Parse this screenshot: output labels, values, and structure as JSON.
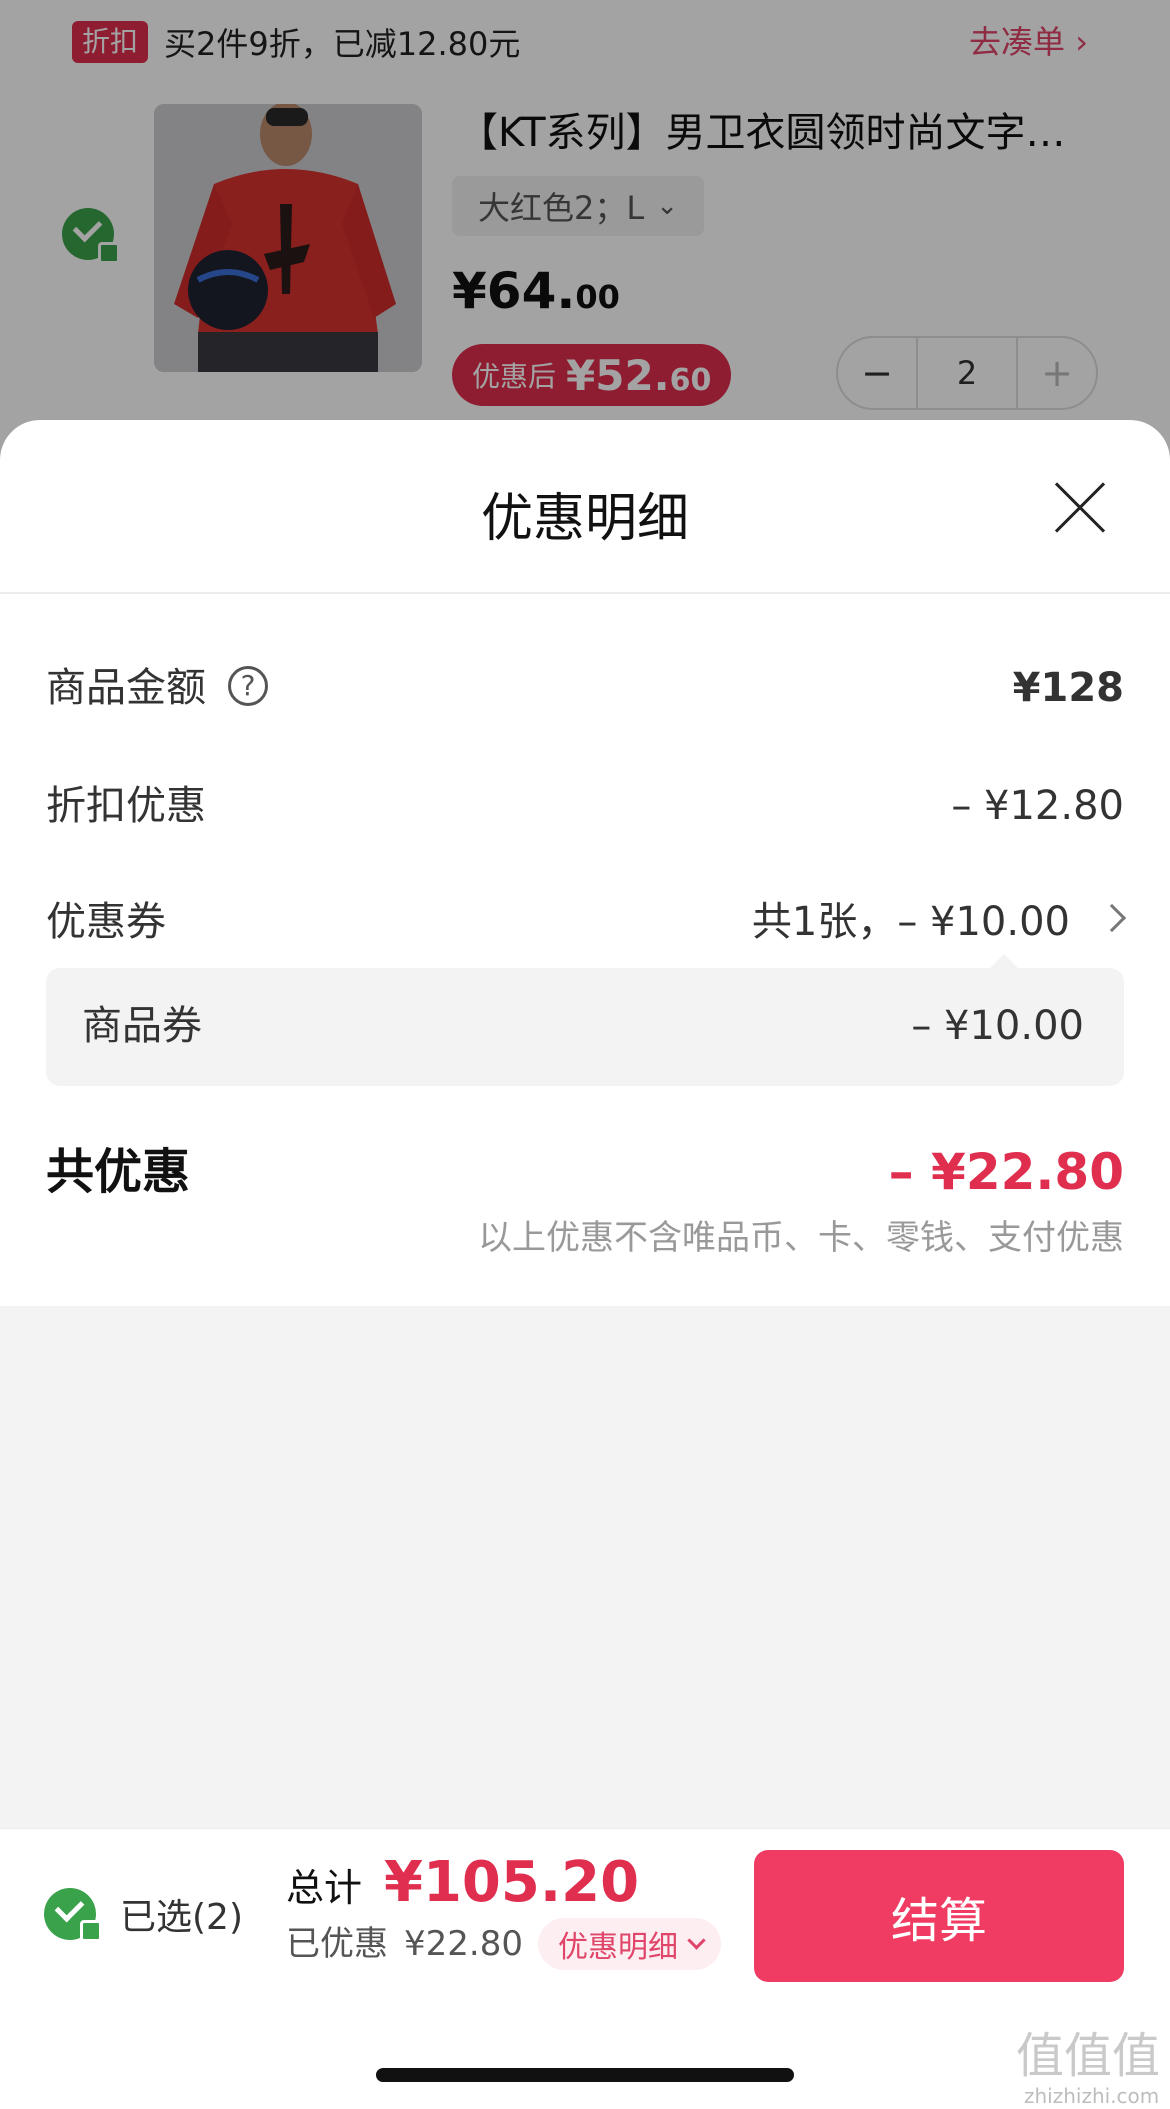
{
  "cart": {
    "promo_tag": "折扣",
    "promo_text": "买2件9折，已减12.80元",
    "promo_link": "去凑单",
    "promo_link_arrow": "›",
    "product": {
      "title": "【KT系列】男卫衣圆领时尚文字…",
      "sku": "大红色2；L",
      "sku_arrow": "⌄",
      "price_main": "¥64.",
      "price_decimal": "00",
      "after_label": "优惠后",
      "after_main": "¥52.",
      "after_decimal": "60",
      "quantity": "2",
      "minus": "−",
      "plus": "+"
    }
  },
  "sheet": {
    "title": "优惠明细",
    "rows": {
      "goods_amount": {
        "label": "商品金额",
        "help": "?",
        "value": "¥128"
      },
      "discount": {
        "label": "折扣优惠",
        "value": "– ¥12.80"
      },
      "coupon": {
        "label": "优惠券",
        "value": "共1张，– ¥10.00"
      },
      "coupon_item": {
        "label": "商品券",
        "value": "– ¥10.00"
      }
    },
    "total_label": "共优惠",
    "total_value": "– ¥22.80",
    "note": "以上优惠不含唯品币、卡、零钱、支付优惠"
  },
  "bottom_bar": {
    "selected_label": "已选(2)",
    "total_label": "总计",
    "total_value": "¥105.20",
    "saved_label": "已优惠",
    "saved_value": "¥22.80",
    "detail_link": "优惠明细",
    "checkout_label": "结算"
  },
  "watermark": {
    "main": "值值值",
    "sub": "zhizhizhi.com"
  },
  "colors": {
    "accent": "#e02e4f",
    "checkout": "#f03c62",
    "check_green": "#3aa24a",
    "text_muted": "#999999"
  }
}
